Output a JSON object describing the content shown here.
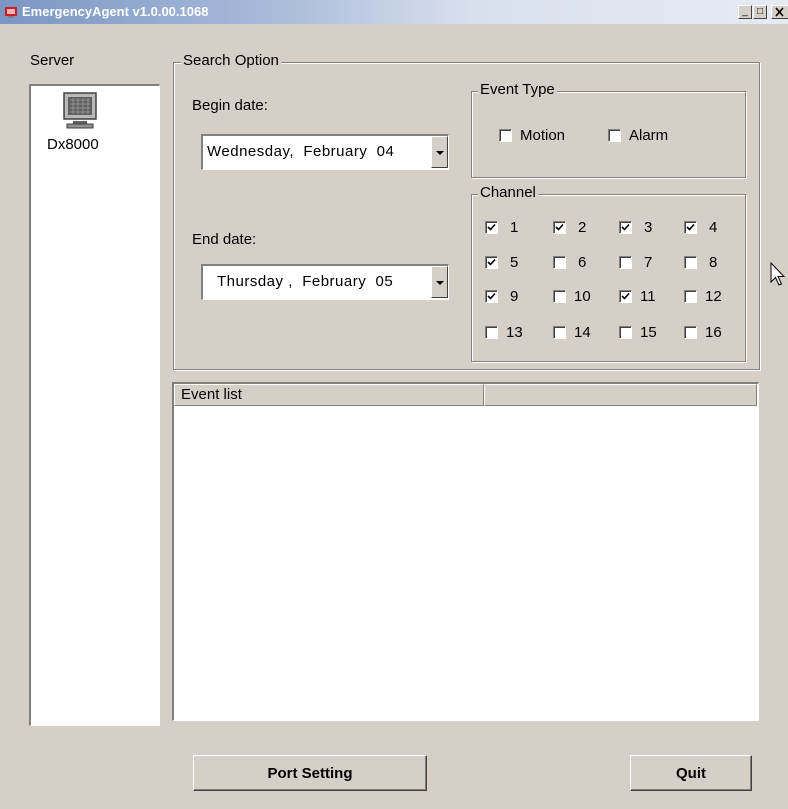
{
  "window": {
    "title": "EmergencyAgent v1.0.00.1068",
    "minimize": "_",
    "maximize": "□"
  },
  "server": {
    "label": "Server",
    "items": [
      {
        "name": "Dx8000",
        "icon": "monitor-icon"
      }
    ]
  },
  "search_option": {
    "label": "Search Option",
    "begin_date_label": "Begin date:",
    "begin_date_value": "Wednesday,  February  04",
    "end_date_label": "End date:",
    "end_date_value": "Thursday ,  February  05"
  },
  "event_type": {
    "label": "Event Type",
    "options": [
      {
        "label": "Motion",
        "checked": false
      },
      {
        "label": "Alarm",
        "checked": false
      }
    ]
  },
  "channel": {
    "label": "Channel",
    "items": [
      {
        "label": "1",
        "checked": true
      },
      {
        "label": "2",
        "checked": true
      },
      {
        "label": "3",
        "checked": true
      },
      {
        "label": "4",
        "checked": true
      },
      {
        "label": "5",
        "checked": true
      },
      {
        "label": "6",
        "checked": false
      },
      {
        "label": "7",
        "checked": false
      },
      {
        "label": "8",
        "checked": false
      },
      {
        "label": "9",
        "checked": true
      },
      {
        "label": "10",
        "checked": false
      },
      {
        "label": "11",
        "checked": true
      },
      {
        "label": "12",
        "checked": false
      },
      {
        "label": "13",
        "checked": false
      },
      {
        "label": "14",
        "checked": false
      },
      {
        "label": "15",
        "checked": false
      },
      {
        "label": "16",
        "checked": false
      }
    ]
  },
  "event_list": {
    "columns": [
      "Event list",
      ""
    ],
    "rows": []
  },
  "buttons": {
    "port_setting": "Port Setting",
    "quit": "Quit"
  }
}
